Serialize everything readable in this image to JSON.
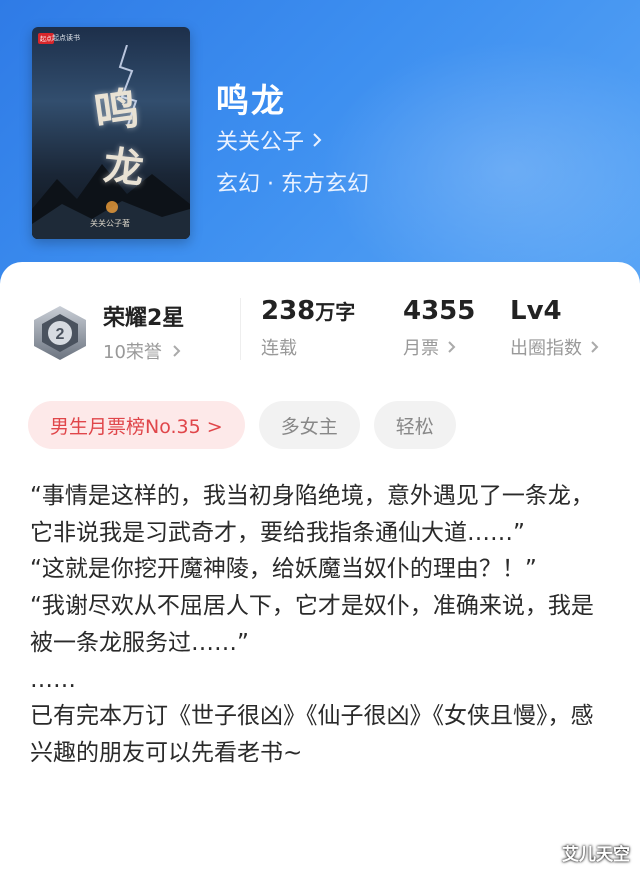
{
  "book": {
    "cover": {
      "badge": "起点",
      "publisher": "起点读书",
      "title_char_1": "鸣",
      "title_char_2": "龙",
      "author_sign": "关关公子著"
    },
    "title": "鸣龙",
    "author": "关关公子",
    "genre": "玄幻 · 东方玄幻"
  },
  "stats": {
    "honor_title": "荣耀2星",
    "honor_sub": "10荣誉",
    "words_value": "238",
    "words_unit": "万字",
    "words_label": "连载",
    "tickets_value": "4355",
    "tickets_label": "月票",
    "level_value": "Lv4",
    "level_label": "出圈指数"
  },
  "tags": [
    {
      "label": "男生月票榜No.35 >"
    },
    {
      "label": "多女主"
    },
    {
      "label": "轻松"
    }
  ],
  "synopsis": [
    "“事情是这样的，我当初身陷绝境，意外遇见了一条龙，它非说我是习武奇才，要给我指条通仙大道……”",
    "“这就是你挖开魔神陵，给妖魔当奴仆的理由？！”",
    "“我谢尽欢从不屈居人下，它才是奴仆，准确来说，我是被一条龙服务过……”",
    "……",
    "已有完本万订《世子很凶》《仙子很凶》《女侠且慢》，感兴趣的朋友可以先看老书~"
  ],
  "watermark": "艾儿天空",
  "colors": {
    "hero": "#3d8ff0",
    "rank_tag_bg": "#fde9e9",
    "rank_tag_text": "#e0464a",
    "tag_bg": "#f2f2f2"
  },
  "icons": {
    "chevron": "chevron-right-icon",
    "honor": "honor-badge-icon"
  }
}
